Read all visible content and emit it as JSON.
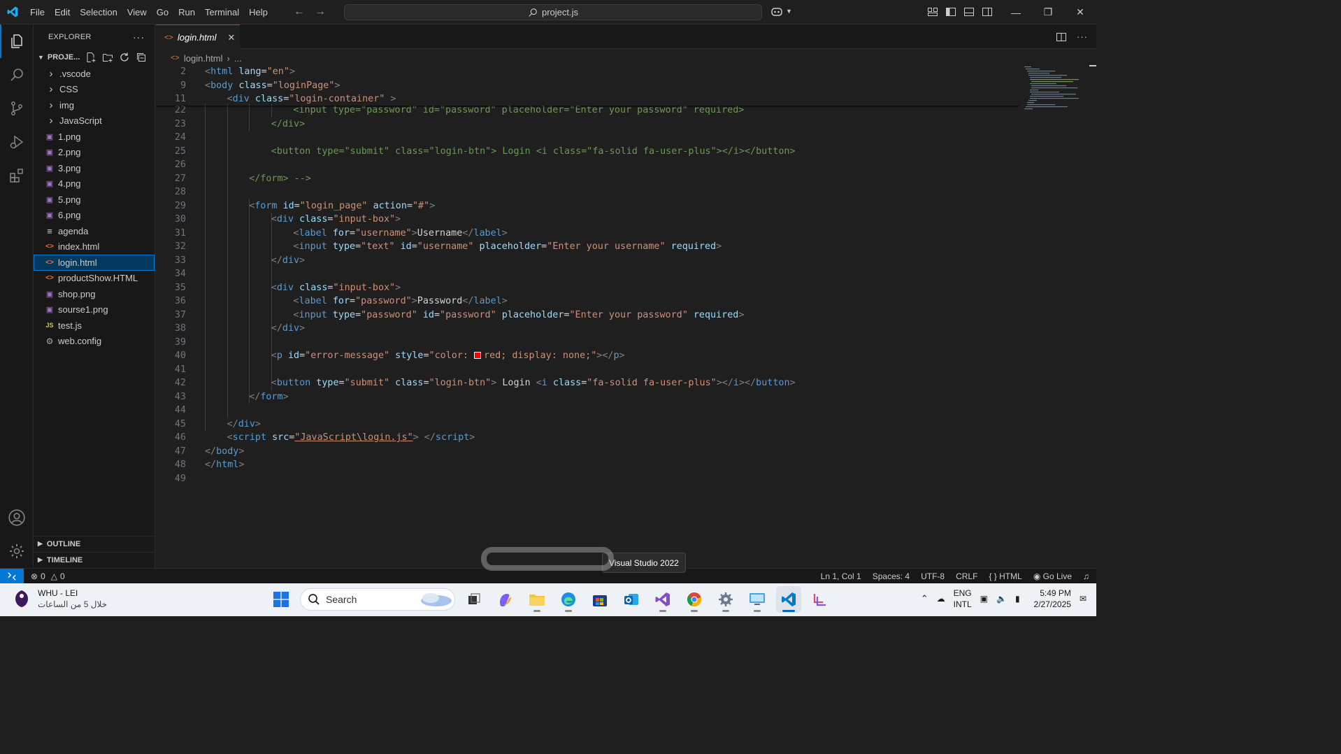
{
  "menu": [
    "File",
    "Edit",
    "Selection",
    "View",
    "Go",
    "Run",
    "Terminal",
    "Help"
  ],
  "command_center": "project.js",
  "explorer": {
    "title": "EXPLORER",
    "project": "PROJE...",
    "items": [
      {
        "label": ".vscode",
        "type": "folder"
      },
      {
        "label": "CSS",
        "type": "folder"
      },
      {
        "label": "img",
        "type": "folder"
      },
      {
        "label": "JavaScript",
        "type": "folder"
      },
      {
        "label": "1.png",
        "type": "image"
      },
      {
        "label": "2.png",
        "type": "image"
      },
      {
        "label": "3.png",
        "type": "image"
      },
      {
        "label": "4.png",
        "type": "image"
      },
      {
        "label": "5.png",
        "type": "image"
      },
      {
        "label": "6.png",
        "type": "image"
      },
      {
        "label": "agenda",
        "type": "text"
      },
      {
        "label": "index.html",
        "type": "html"
      },
      {
        "label": "login.html",
        "type": "html",
        "selected": true
      },
      {
        "label": "productShow.HTML",
        "type": "html"
      },
      {
        "label": "shop.png",
        "type": "image"
      },
      {
        "label": "sourse1.png",
        "type": "image"
      },
      {
        "label": "test.js",
        "type": "js"
      },
      {
        "label": "web.config",
        "type": "config"
      }
    ],
    "outline": "OUTLINE",
    "timeline": "TIMELINE"
  },
  "tab": {
    "label": "login.html"
  },
  "breadcrumb": {
    "file": "login.html",
    "rest": "..."
  },
  "code_lines": [
    {
      "n": "2",
      "indent": 0,
      "tokens": [
        [
          "br",
          "<"
        ],
        [
          "t",
          "html"
        ],
        [
          "tx",
          " "
        ],
        [
          "a",
          "lang"
        ],
        [
          "tx",
          "="
        ],
        [
          "s",
          "\"en\""
        ],
        [
          "br",
          ">"
        ]
      ]
    },
    {
      "n": "9",
      "indent": 0,
      "tokens": [
        [
          "br",
          "<"
        ],
        [
          "t",
          "body"
        ],
        [
          "tx",
          " "
        ],
        [
          "a",
          "class"
        ],
        [
          "tx",
          "="
        ],
        [
          "s",
          "\"loginPage\""
        ],
        [
          "br",
          ">"
        ]
      ]
    },
    {
      "n": "11",
      "indent": 1,
      "tokens": [
        [
          "br",
          "<"
        ],
        [
          "t",
          "div"
        ],
        [
          "tx",
          " "
        ],
        [
          "a",
          "class"
        ],
        [
          "tx",
          "="
        ],
        [
          "s",
          "\"login-container\""
        ],
        [
          "tx",
          " "
        ],
        [
          "br",
          ">"
        ]
      ]
    },
    {
      "n": "22",
      "indent": 4,
      "tokens": [
        [
          "cm",
          "<input type=\"password\" id=\"password\" placeholder=\"Enter your password\" required>"
        ]
      ]
    },
    {
      "n": "23",
      "indent": 3,
      "tokens": [
        [
          "cm",
          "</div>"
        ]
      ]
    },
    {
      "n": "24",
      "indent": 0,
      "tokens": []
    },
    {
      "n": "25",
      "indent": 3,
      "tokens": [
        [
          "cm",
          "<button type=\"submit\" class=\"login-btn\"> Login <i class=\"fa-solid fa-user-plus\"></i></button>"
        ]
      ]
    },
    {
      "n": "26",
      "indent": 0,
      "tokens": []
    },
    {
      "n": "27",
      "indent": 2,
      "tokens": [
        [
          "cm",
          "</form> -->"
        ]
      ]
    },
    {
      "n": "28",
      "indent": 0,
      "tokens": []
    },
    {
      "n": "29",
      "indent": 2,
      "tokens": [
        [
          "br",
          "<"
        ],
        [
          "t",
          "form"
        ],
        [
          "tx",
          " "
        ],
        [
          "a",
          "id"
        ],
        [
          "tx",
          "="
        ],
        [
          "s",
          "\"login_page\""
        ],
        [
          "tx",
          " "
        ],
        [
          "a",
          "action"
        ],
        [
          "tx",
          "="
        ],
        [
          "s",
          "\"#\""
        ],
        [
          "br",
          ">"
        ]
      ]
    },
    {
      "n": "30",
      "indent": 3,
      "tokens": [
        [
          "br",
          "<"
        ],
        [
          "t",
          "div"
        ],
        [
          "tx",
          " "
        ],
        [
          "a",
          "class"
        ],
        [
          "tx",
          "="
        ],
        [
          "s",
          "\"input-box\""
        ],
        [
          "br",
          ">"
        ]
      ]
    },
    {
      "n": "31",
      "indent": 4,
      "tokens": [
        [
          "br",
          "<"
        ],
        [
          "t",
          "label"
        ],
        [
          "tx",
          " "
        ],
        [
          "a",
          "for"
        ],
        [
          "tx",
          "="
        ],
        [
          "s",
          "\"username\""
        ],
        [
          "br",
          ">"
        ],
        [
          "tx",
          "Username"
        ],
        [
          "br",
          "</"
        ],
        [
          "t",
          "label"
        ],
        [
          "br",
          ">"
        ]
      ]
    },
    {
      "n": "32",
      "indent": 4,
      "tokens": [
        [
          "br",
          "<"
        ],
        [
          "t",
          "input"
        ],
        [
          "tx",
          " "
        ],
        [
          "a",
          "type"
        ],
        [
          "tx",
          "="
        ],
        [
          "s",
          "\"text\""
        ],
        [
          "tx",
          " "
        ],
        [
          "a",
          "id"
        ],
        [
          "tx",
          "="
        ],
        [
          "s",
          "\"username\""
        ],
        [
          "tx",
          " "
        ],
        [
          "a",
          "placeholder"
        ],
        [
          "tx",
          "="
        ],
        [
          "s",
          "\"Enter your username\""
        ],
        [
          "tx",
          " "
        ],
        [
          "a",
          "required"
        ],
        [
          "br",
          ">"
        ]
      ]
    },
    {
      "n": "33",
      "indent": 3,
      "tokens": [
        [
          "br",
          "</"
        ],
        [
          "t",
          "div"
        ],
        [
          "br",
          ">"
        ]
      ]
    },
    {
      "n": "34",
      "indent": 0,
      "tokens": []
    },
    {
      "n": "35",
      "indent": 3,
      "tokens": [
        [
          "br",
          "<"
        ],
        [
          "t",
          "div"
        ],
        [
          "tx",
          " "
        ],
        [
          "a",
          "class"
        ],
        [
          "tx",
          "="
        ],
        [
          "s",
          "\"input-box\""
        ],
        [
          "br",
          ">"
        ]
      ]
    },
    {
      "n": "36",
      "indent": 4,
      "tokens": [
        [
          "br",
          "<"
        ],
        [
          "t",
          "label"
        ],
        [
          "tx",
          " "
        ],
        [
          "a",
          "for"
        ],
        [
          "tx",
          "="
        ],
        [
          "s",
          "\"password\""
        ],
        [
          "br",
          ">"
        ],
        [
          "tx",
          "Password"
        ],
        [
          "br",
          "</"
        ],
        [
          "t",
          "label"
        ],
        [
          "br",
          ">"
        ]
      ]
    },
    {
      "n": "37",
      "indent": 4,
      "tokens": [
        [
          "br",
          "<"
        ],
        [
          "t",
          "input"
        ],
        [
          "tx",
          " "
        ],
        [
          "a",
          "type"
        ],
        [
          "tx",
          "="
        ],
        [
          "s",
          "\"password\""
        ],
        [
          "tx",
          " "
        ],
        [
          "a",
          "id"
        ],
        [
          "tx",
          "="
        ],
        [
          "s",
          "\"password\""
        ],
        [
          "tx",
          " "
        ],
        [
          "a",
          "placeholder"
        ],
        [
          "tx",
          "="
        ],
        [
          "s",
          "\"Enter your password\""
        ],
        [
          "tx",
          " "
        ],
        [
          "a",
          "required"
        ],
        [
          "br",
          ">"
        ]
      ]
    },
    {
      "n": "38",
      "indent": 3,
      "tokens": [
        [
          "br",
          "</"
        ],
        [
          "t",
          "div"
        ],
        [
          "br",
          ">"
        ]
      ]
    },
    {
      "n": "39",
      "indent": 0,
      "tokens": []
    },
    {
      "n": "40",
      "indent": 3,
      "tokens": [
        [
          "br",
          "<"
        ],
        [
          "t",
          "p"
        ],
        [
          "tx",
          " "
        ],
        [
          "a",
          "id"
        ],
        [
          "tx",
          "="
        ],
        [
          "s",
          "\"error-message\""
        ],
        [
          "tx",
          " "
        ],
        [
          "a",
          "style"
        ],
        [
          "tx",
          "="
        ],
        [
          "s",
          "\"color: "
        ],
        [
          "swatch",
          ""
        ],
        [
          "s",
          "red; display: none;\""
        ],
        [
          "br",
          "></"
        ],
        [
          "t",
          "p"
        ],
        [
          "br",
          ">"
        ]
      ]
    },
    {
      "n": "41",
      "indent": 0,
      "tokens": []
    },
    {
      "n": "42",
      "indent": 3,
      "tokens": [
        [
          "br",
          "<"
        ],
        [
          "t",
          "button"
        ],
        [
          "tx",
          " "
        ],
        [
          "a",
          "type"
        ],
        [
          "tx",
          "="
        ],
        [
          "s",
          "\"submit\""
        ],
        [
          "tx",
          " "
        ],
        [
          "a",
          "class"
        ],
        [
          "tx",
          "="
        ],
        [
          "s",
          "\"login-btn\""
        ],
        [
          "br",
          ">"
        ],
        [
          "tx",
          " Login "
        ],
        [
          "br",
          "<"
        ],
        [
          "t",
          "i"
        ],
        [
          "tx",
          " "
        ],
        [
          "a",
          "class"
        ],
        [
          "tx",
          "="
        ],
        [
          "s",
          "\"fa-solid fa-user-plus\""
        ],
        [
          "br",
          "></"
        ],
        [
          "t",
          "i"
        ],
        [
          "br",
          "></"
        ],
        [
          "t",
          "button"
        ],
        [
          "br",
          ">"
        ]
      ]
    },
    {
      "n": "43",
      "indent": 2,
      "tokens": [
        [
          "br",
          "</"
        ],
        [
          "t",
          "form"
        ],
        [
          "br",
          ">"
        ]
      ]
    },
    {
      "n": "44",
      "indent": 0,
      "tokens": []
    },
    {
      "n": "45",
      "indent": 1,
      "tokens": [
        [
          "br",
          "</"
        ],
        [
          "t",
          "div"
        ],
        [
          "br",
          ">"
        ]
      ]
    },
    {
      "n": "46",
      "indent": 1,
      "tokens": [
        [
          "br",
          "<"
        ],
        [
          "t",
          "script"
        ],
        [
          "tx",
          " "
        ],
        [
          "a",
          "src"
        ],
        [
          "tx",
          "="
        ],
        [
          "s",
          "\"JavaScript\\login.js\""
        ],
        [
          "br",
          ">"
        ],
        [
          "tx",
          " "
        ],
        [
          "br",
          "</"
        ],
        [
          "t",
          "script"
        ],
        [
          "br",
          ">"
        ]
      ]
    },
    {
      "n": "47",
      "indent": 0,
      "tokens": [
        [
          "br",
          "</"
        ],
        [
          "t",
          "body"
        ],
        [
          "br",
          ">"
        ]
      ]
    },
    {
      "n": "48",
      "indent": 0,
      "tokens": [
        [
          "br",
          "</"
        ],
        [
          "t",
          "html"
        ],
        [
          "br",
          ">"
        ]
      ]
    },
    {
      "n": "49",
      "indent": 0,
      "tokens": []
    }
  ],
  "status": {
    "errors": "0",
    "warnings": "0",
    "position": "Ln 1, Col 1",
    "spaces": "Spaces: 4",
    "encoding": "UTF-8",
    "eol": "CRLF",
    "language": "HTML",
    "golive": "Go Live"
  },
  "tooltip": "Visual Studio 2022",
  "taskbar": {
    "weather_title": "WHU - LEI",
    "weather_sub": "خلال 5 من الساعات",
    "search": "Search",
    "lang1": "ENG",
    "lang2": "INTL",
    "time": "5:49 PM",
    "date": "2/27/2025"
  },
  "colors": {
    "accent": "#0078d4",
    "selection": "#04395e",
    "editor_bg": "#1f1f1f"
  }
}
